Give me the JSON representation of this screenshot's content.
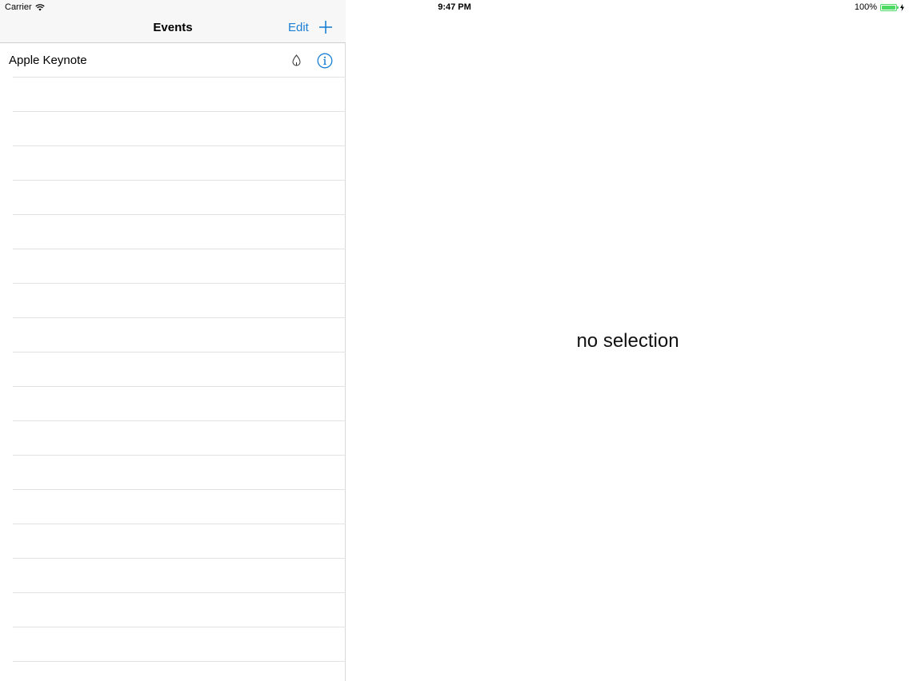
{
  "status_bar": {
    "carrier": "Carrier",
    "time": "9:47 PM",
    "battery_percent": "100%",
    "battery_level": 1.0,
    "battery_color": "#4cd964"
  },
  "master": {
    "title": "Events",
    "edit_label": "Edit",
    "add_icon": "plus-icon",
    "accent_color": "#1a7fd4",
    "events": [
      {
        "title": "Apple Keynote",
        "icons": [
          "drop-icon",
          "info-icon"
        ]
      }
    ],
    "empty_row_count": 17
  },
  "detail": {
    "placeholder": "no selection"
  }
}
